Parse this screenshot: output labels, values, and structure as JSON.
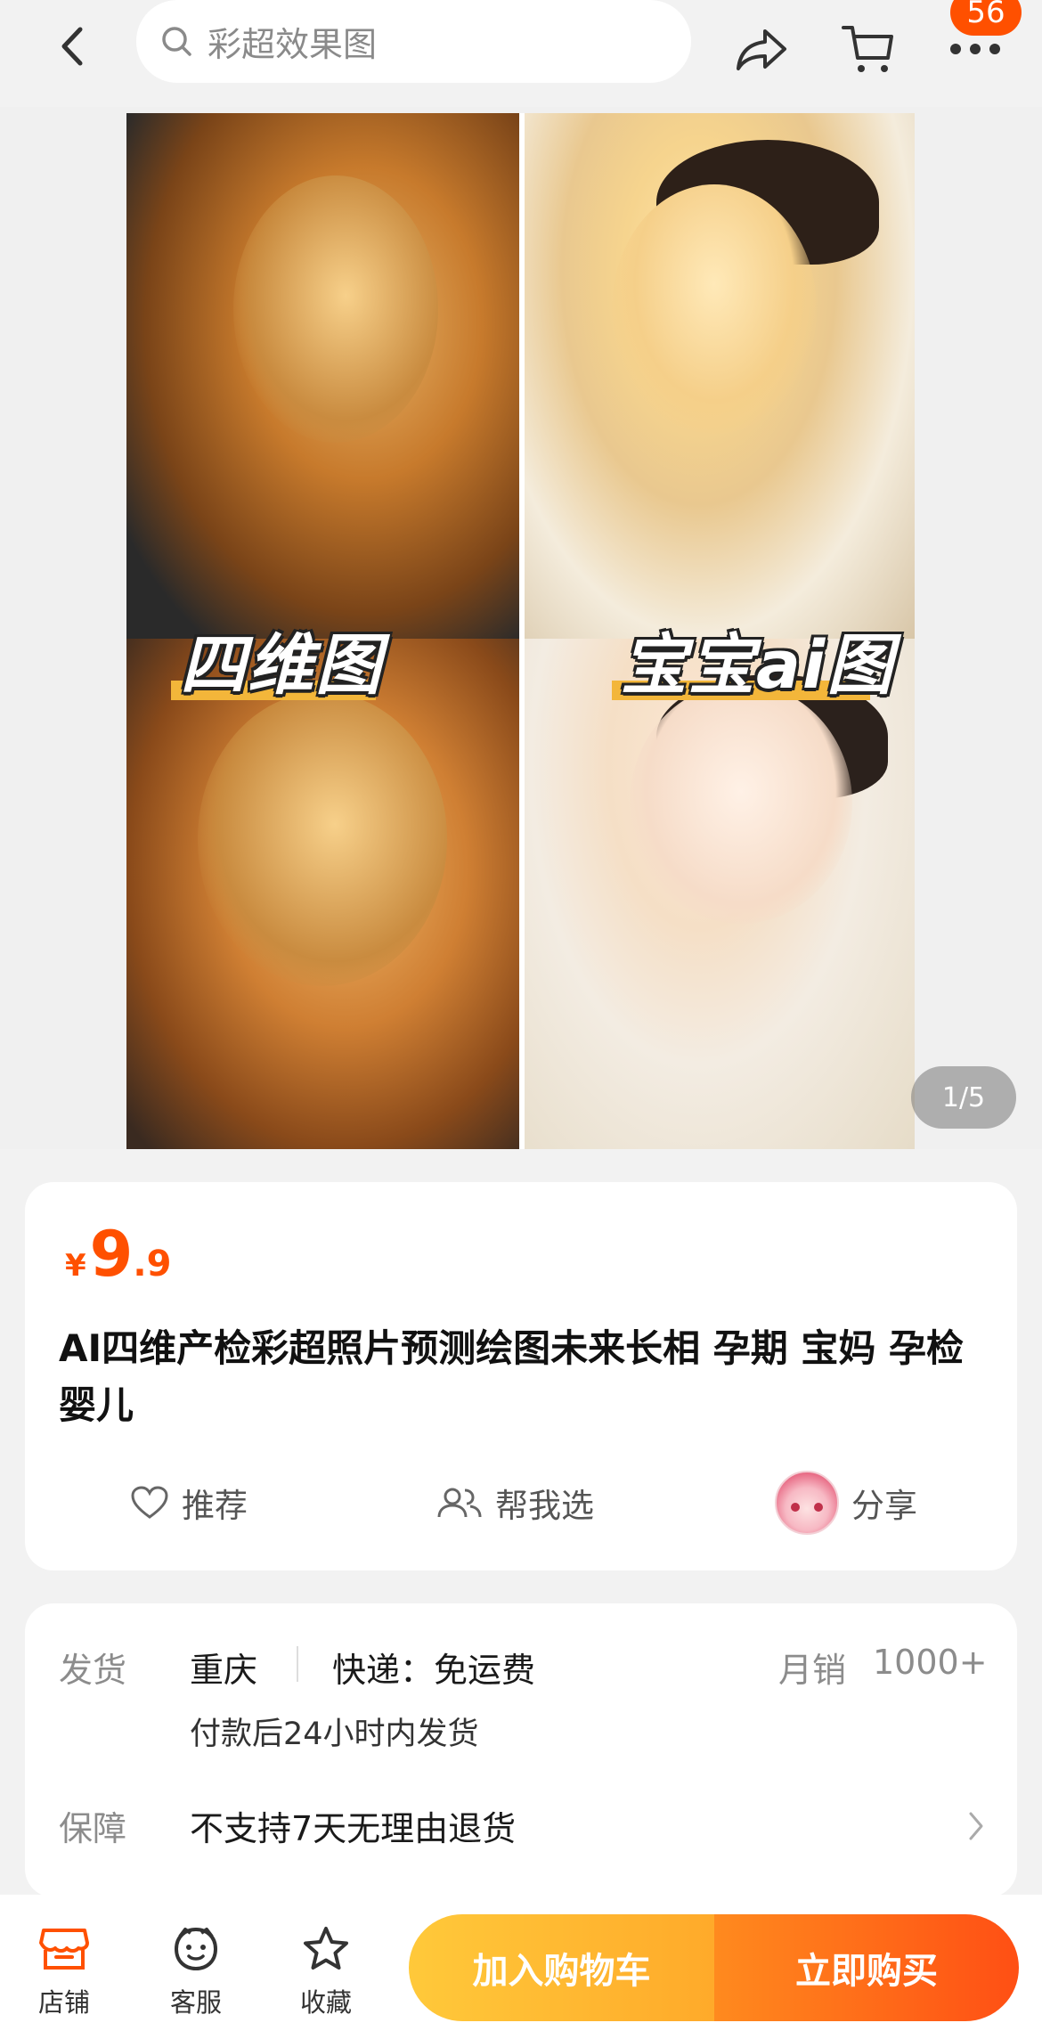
{
  "header": {
    "search_placeholder": "彩超效果图",
    "badge_count": "56",
    "icons": [
      "back-icon",
      "search-icon",
      "share-icon",
      "cart-icon",
      "more-icon"
    ]
  },
  "gallery": {
    "label_left": "四维图",
    "label_right": "宝宝ai图",
    "pager": "1/5"
  },
  "product": {
    "currency": "¥",
    "price_int": "9",
    "price_dec": ".9",
    "title": "AI四维产检彩超照片预测绘图未来长相 孕期 宝妈 孕检 婴儿",
    "actions": {
      "recommend": "推荐",
      "help_choose": "帮我选",
      "share": "分享"
    }
  },
  "shipping": {
    "ship_label": "发货",
    "origin": "重庆",
    "express": "快递：免运费",
    "sales_label": "月销",
    "sales_value": "1000+",
    "ship_time": "付款后24小时内发货",
    "guarantee_label": "保障",
    "guarantee_value": "不支持7天无理由退货"
  },
  "bottom_bar": {
    "store": "店铺",
    "service": "客服",
    "favorite": "收藏",
    "add_cart": "加入购物车",
    "buy_now": "立即购买"
  },
  "colors": {
    "accent": "#ff5000",
    "cart_button": "#ffb52e",
    "buy_button": "#ff5a16"
  }
}
